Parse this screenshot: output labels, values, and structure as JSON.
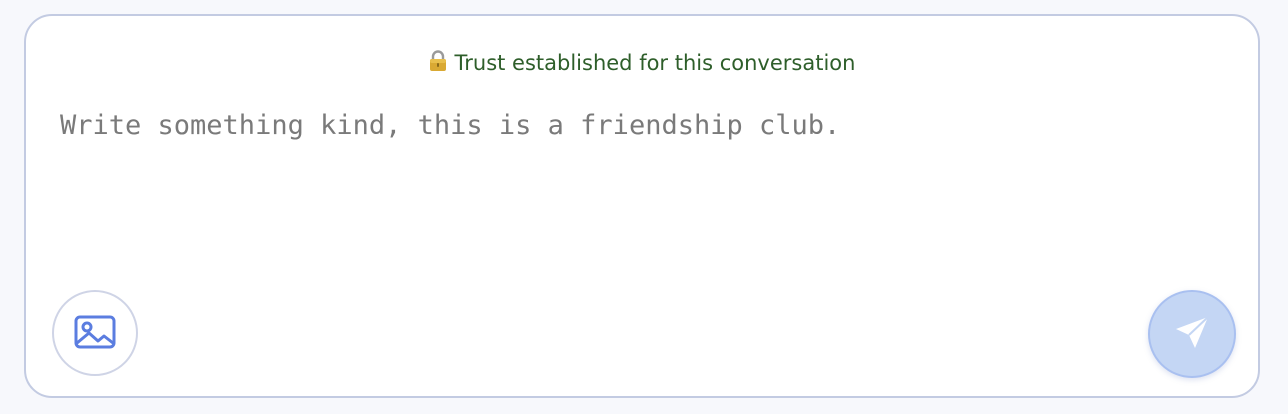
{
  "composer": {
    "trust_text": "Trust established for this conversation",
    "input_value": "",
    "input_placeholder": "Write something kind, this is a friendship club.",
    "attach_icon": "image-icon",
    "send_icon": "paper-plane-icon",
    "colors": {
      "trust_text": "#2e5e2a",
      "border": "#c3cbe2",
      "attach_icon": "#5b7de0",
      "send_bg": "#c4d6f4",
      "send_icon": "#ffffff"
    }
  }
}
